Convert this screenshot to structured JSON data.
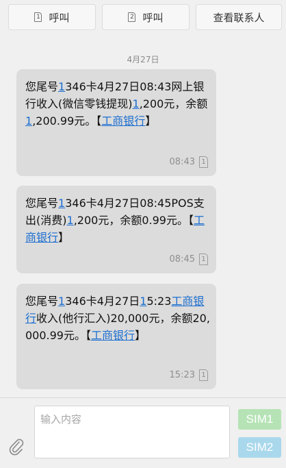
{
  "toolbar": {
    "call1_label": "呼叫",
    "call1_sim": "1",
    "call2_label": "呼叫",
    "call2_sim": "2",
    "contact_label": "查看联系人"
  },
  "date_separator": "4月27日",
  "messages": [
    {
      "parts": [
        {
          "t": "您尾号"
        },
        {
          "t": "1",
          "link": true
        },
        {
          "t": "346卡4月27日08:43网上银行收入(微信零钱提现)"
        },
        {
          "t": "1",
          "link": true
        },
        {
          "t": ",200元，余额"
        },
        {
          "t": "1",
          "link": true
        },
        {
          "t": ",200.99元。【"
        },
        {
          "t": "工商银行",
          "link": true
        },
        {
          "t": "】"
        }
      ],
      "time": "08:43",
      "sim": "1"
    },
    {
      "parts": [
        {
          "t": "您尾号"
        },
        {
          "t": "1",
          "link": true
        },
        {
          "t": "346卡4月27日08:45POS支出(消费)"
        },
        {
          "t": "1",
          "link": true
        },
        {
          "t": ",200元，余额0.99元。【"
        },
        {
          "t": "工商银行",
          "link": true
        },
        {
          "t": "】"
        }
      ],
      "time": "08:45",
      "sim": "1"
    },
    {
      "parts": [
        {
          "t": "您尾号"
        },
        {
          "t": "1",
          "link": true
        },
        {
          "t": "346卡4月27日"
        },
        {
          "t": "1",
          "link": true
        },
        {
          "t": "5:23"
        },
        {
          "t": "工商银行",
          "link": true
        },
        {
          "t": "收入(他行汇入)20,000元，余额20,000.99元。【"
        },
        {
          "t": "工商银行",
          "link": true
        },
        {
          "t": "】"
        }
      ],
      "time": "15:23",
      "sim": "1"
    }
  ],
  "composer": {
    "placeholder": "输入内容",
    "sim1_label": "SIM1",
    "sim2_label": "SIM2"
  },
  "colors": {
    "bubble": "#dcdcdc",
    "link": "#1a6dd0",
    "sim1_button": "#b6e3b6",
    "sim2_button": "#a9d8ec"
  },
  "icons": {
    "attach": "paperclip-icon",
    "sim": "sim-card-icon"
  }
}
